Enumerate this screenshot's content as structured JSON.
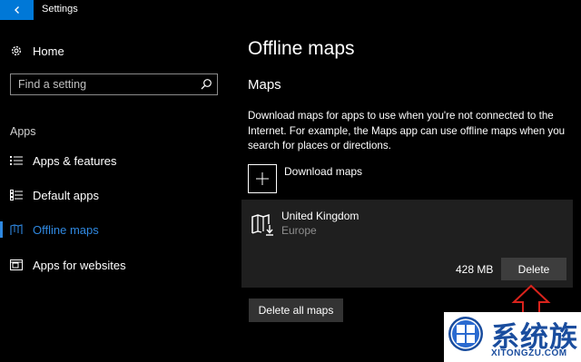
{
  "window": {
    "title": "Settings"
  },
  "sidebar": {
    "home_label": "Home",
    "search_placeholder": "Find a setting",
    "section_title": "Apps",
    "items": [
      {
        "label": "Apps & features",
        "icon": "list-icon"
      },
      {
        "label": "Default apps",
        "icon": "default-apps-icon"
      },
      {
        "label": "Offline maps",
        "icon": "map-icon",
        "active": true
      },
      {
        "label": "Apps for websites",
        "icon": "web-apps-icon"
      }
    ]
  },
  "main": {
    "title": "Offline maps",
    "subtitle": "Maps",
    "description": "Download maps for apps to use when you're not connected to the Internet. For example, the Maps app can use offline maps when you search for places or directions.",
    "download_label": "Download maps",
    "map_item": {
      "name": "United Kingdom",
      "region": "Europe",
      "size": "428 MB",
      "delete_label": "Delete"
    },
    "delete_all_label": "Delete all maps"
  },
  "watermark": {
    "title": "系统族",
    "url": "XITONGZU.COM"
  },
  "colors": {
    "accent": "#0078d7",
    "active_link": "#2f88e0",
    "card_bg": "#1f1f1f",
    "arrow": "#d9231c",
    "watermark_blue": "#1a4d9e"
  }
}
